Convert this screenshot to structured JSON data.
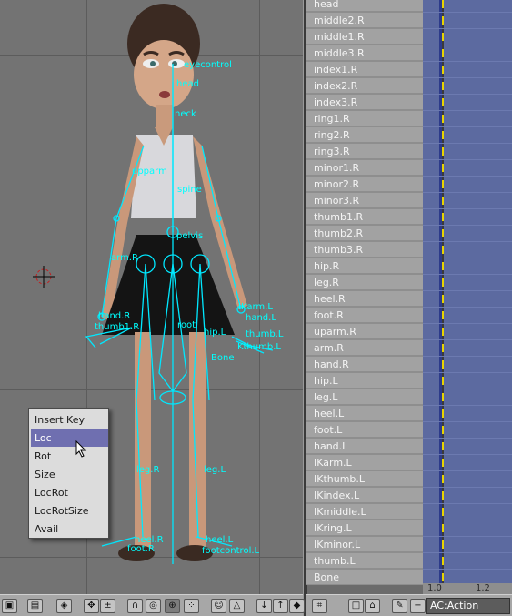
{
  "viewport": {
    "bone_labels": [
      "head",
      "neck",
      "spine",
      "pelvis",
      "upparm",
      "arm.R",
      "hand.R",
      "thumb1.R",
      "IKarm.L",
      "hand.L",
      "thumb.L",
      "Bone",
      "IKthumb.L",
      "root",
      "hip.L",
      "leg.R",
      "leg.L",
      "heel.L",
      "heel.R",
      "foot.R",
      "footcontrol.L",
      "eyecontrol"
    ]
  },
  "popup_menu": {
    "items": [
      "Insert Key",
      "Loc",
      "Rot",
      "Size",
      "LocRot",
      "LocRotSize",
      "Avail"
    ],
    "selected": "Loc"
  },
  "channels": [
    "head",
    "middle2.R",
    "middle1.R",
    "middle3.R",
    "index1.R",
    "index2.R",
    "index3.R",
    "ring1.R",
    "ring2.R",
    "ring3.R",
    "minor1.R",
    "minor2.R",
    "minor3.R",
    "thumb1.R",
    "thumb2.R",
    "thumb3.R",
    "hip.R",
    "leg.R",
    "heel.R",
    "foot.R",
    "uparm.R",
    "arm.R",
    "hand.R",
    "hip.L",
    "leg.L",
    "heel.L",
    "foot.L",
    "hand.L",
    "IKarm.L",
    "IKthumb.L",
    "IKindex.L",
    "IKmiddle.L",
    "IKring.L",
    "IKminor.L",
    "thumb.L",
    "Bone"
  ],
  "timeline": {
    "ruler": [
      "1.0",
      "1.2"
    ]
  },
  "header": {
    "action_field": "AC:Action",
    "buttons": [
      "cube-view-icon",
      "layers-icon",
      "render-icon",
      "move-icon",
      "plus-minus-icon",
      "magnet-icon",
      "proportional-icon",
      "snap-icon",
      "smiley-icon",
      "triangle-icon",
      "arrow-down-icon",
      "arrow-up-icon",
      "keyframe-icon"
    ]
  },
  "colors": {
    "bone": "#00ffff",
    "timeline": "#5c6aa0",
    "keyframe": "#e8d400",
    "menu_selected": "#6f6fb0"
  }
}
